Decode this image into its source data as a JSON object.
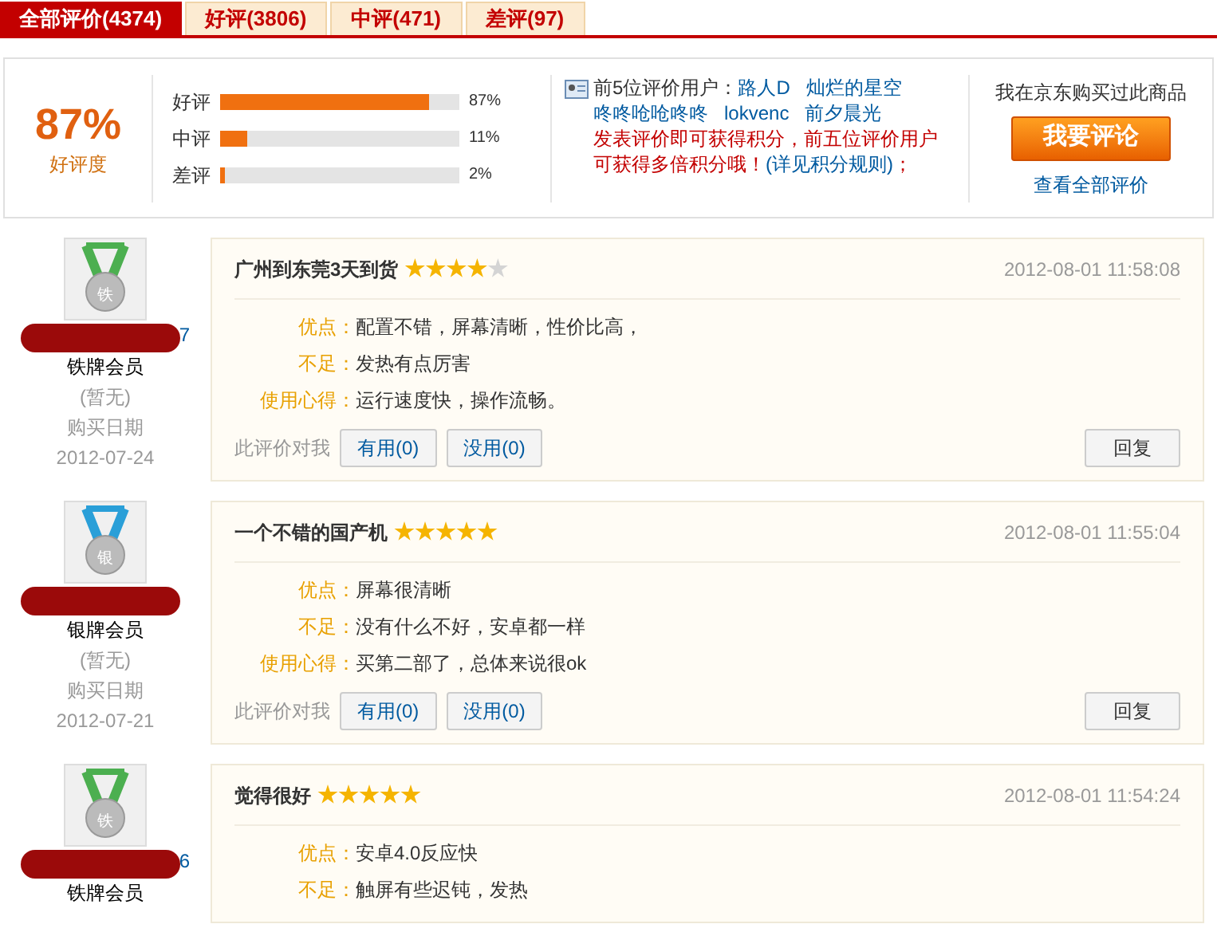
{
  "tabs": [
    {
      "label": "全部评价(4374)",
      "selected": true
    },
    {
      "label": "好评(3806)",
      "selected": false
    },
    {
      "label": "中评(471)",
      "selected": false
    },
    {
      "label": "差评(97)",
      "selected": false
    }
  ],
  "summary": {
    "rate": "87%",
    "rate_label": "好评度",
    "bars": [
      {
        "label": "好评",
        "level": 0.87,
        "reading": "87%"
      },
      {
        "label": "中评",
        "level": 0.11,
        "reading": "11%"
      },
      {
        "label": "差评",
        "level": 0.02,
        "reading": "2%"
      }
    ],
    "top_users_label": "前5位评价用户：",
    "top_users": [
      "路人D",
      "灿烂的星空",
      "咚咚呛呛咚咚",
      "lokvenc",
      "前夕晨光"
    ],
    "notice": "发表评价即可获得积分，前五位评价用户可获得多倍积分哦！",
    "rules_link": "(详见积分规则)",
    "notice_end": "；",
    "bought_text": "我在京东购买过此商品",
    "review_button": "我要评论",
    "view_all_link": "查看全部评价"
  },
  "reviews": [
    {
      "badge": "铁",
      "kind": "iron",
      "username_fragment": "7",
      "member_level": "铁牌会员",
      "extra": "(暂无)",
      "purchase_label": "购买日期",
      "purchase_date": "2012-07-24",
      "title": "广州到东莞3天到货",
      "stars": 4,
      "time": "2012-08-01 11:58:08",
      "fields": [
        {
          "label": "优点：",
          "text": "配置不错，屏幕清晰，性价比高，"
        },
        {
          "label": "不足：",
          "text": "发热有点厉害"
        },
        {
          "label": "使用心得：",
          "text": "运行速度快，操作流畅。"
        }
      ],
      "helpful_label": "此评价对我",
      "useful": "有用(0)",
      "useless": "没用(0)",
      "reply": "回复"
    },
    {
      "badge": "银",
      "kind": "silver",
      "member_level": "银牌会员",
      "extra": "(暂无)",
      "purchase_label": "购买日期",
      "purchase_date": "2012-07-21",
      "title": "一个不错的国产机",
      "stars": 5,
      "time": "2012-08-01 11:55:04",
      "fields": [
        {
          "label": "优点：",
          "text": "屏幕很清晰"
        },
        {
          "label": "不足：",
          "text": "没有什么不好，安卓都一样"
        },
        {
          "label": "使用心得：",
          "text": "买第二部了，总体来说很ok"
        }
      ],
      "helpful_label": "此评价对我",
      "useful": "有用(0)",
      "useless": "没用(0)",
      "reply": "回复"
    },
    {
      "badge": "铁",
      "kind": "iron",
      "username_fragment": "6",
      "member_level": "铁牌会员",
      "title": "觉得很好",
      "stars": 5,
      "time": "2012-08-01 11:54:24",
      "fields": [
        {
          "label": "优点：",
          "text": "安卓4.0反应快"
        },
        {
          "label": "不足：",
          "text": "触屏有些迟钝，发热"
        }
      ]
    }
  ]
}
